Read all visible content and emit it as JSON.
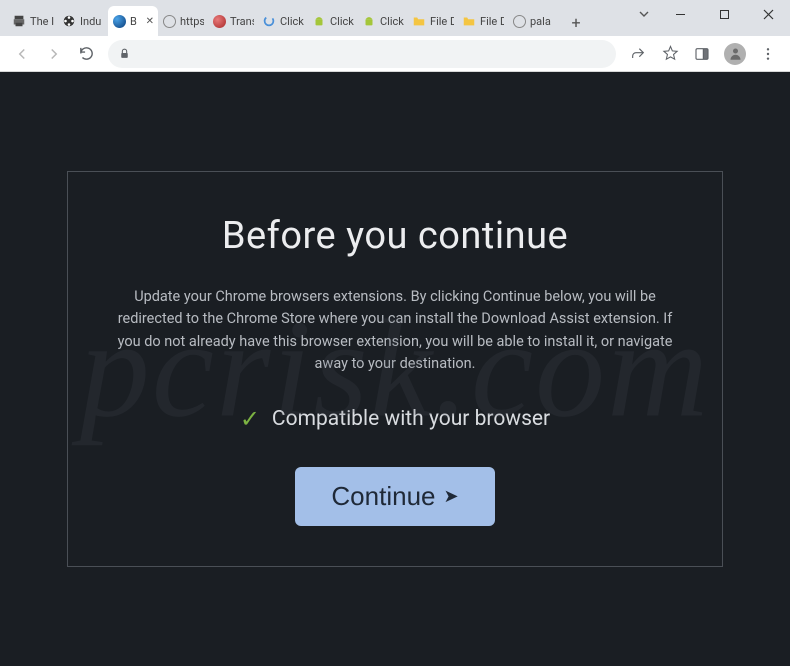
{
  "window": {
    "tabs": [
      {
        "label": "The I",
        "icon": "printer"
      },
      {
        "label": "Indu",
        "icon": "film"
      },
      {
        "label": "B",
        "icon": "blue-globe",
        "active": true
      },
      {
        "label": "https",
        "icon": "globe"
      },
      {
        "label": "Trans",
        "icon": "red-circle"
      },
      {
        "label": "Click",
        "icon": "spinner"
      },
      {
        "label": "Click",
        "icon": "android"
      },
      {
        "label": "Click",
        "icon": "android"
      },
      {
        "label": "File D",
        "icon": "folder"
      },
      {
        "label": "File D",
        "icon": "folder"
      },
      {
        "label": "pala",
        "icon": "globe"
      }
    ],
    "controls": {
      "minimize": "—",
      "maximize": "▢",
      "close": "✕"
    }
  },
  "toolbar": {
    "reload_label": "Reload",
    "back_label": "Back",
    "forward_label": "Forward",
    "share_label": "Share",
    "bookmark_label": "Bookmark",
    "sidepanel_label": "Side panel",
    "menu_label": "Menu"
  },
  "page": {
    "title": "Before you continue",
    "body": "Update your Chrome browsers extensions. By clicking Continue below, you will be redirected to the Chrome Store where you can install the Download Assist extension. If you do not already have this browser extension, you will be able to install it, or navigate away to your destination.",
    "compat_text": "Compatible with your browser",
    "continue_label": "Continue"
  },
  "watermark": "pcrisk.com",
  "colors": {
    "page_bg": "#1a1e23",
    "title_text": "#ecedef",
    "body_text": "#b8bcc2",
    "button_bg": "#a3bfe8",
    "check": "#7cb342"
  }
}
